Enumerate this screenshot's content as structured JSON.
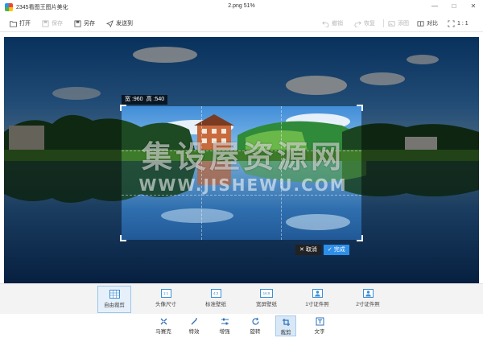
{
  "window": {
    "app_title": "2345看图王图片美化",
    "file_title": "2.png  51%",
    "controls": [
      "—",
      "□",
      "✕"
    ]
  },
  "toolbar": {
    "open": "打开",
    "save": "保存",
    "save_as": "另存",
    "send_to": "发送到",
    "undo": "撤销",
    "redo": "恢复",
    "add_image": "添图",
    "compare": "对比",
    "ratio": "1 : 1"
  },
  "crop": {
    "width_label": "宽 :960",
    "height_label": "高 :540",
    "cancel": "取消",
    "done": "完成"
  },
  "watermark": {
    "line1": "集设屋资源网",
    "line2": "WWW.JISHEWU.COM"
  },
  "presets": [
    {
      "label": "自由裁剪",
      "icon": "",
      "active": true
    },
    {
      "label": "头像尺寸",
      "icon": "1:1",
      "active": false
    },
    {
      "label": "标准壁纸",
      "icon": "4:3",
      "active": false
    },
    {
      "label": "宽屏壁纸",
      "icon": "16:9",
      "active": false
    },
    {
      "label": "1寸证件照",
      "icon": "person",
      "active": false
    },
    {
      "label": "2寸证件照",
      "icon": "person",
      "active": false
    }
  ],
  "tools": [
    {
      "label": "马赛克",
      "icon": "mosaic-icon",
      "active": false
    },
    {
      "label": "特效",
      "icon": "magic-wand-icon",
      "active": false
    },
    {
      "label": "增强",
      "icon": "sliders-icon",
      "active": false
    },
    {
      "label": "旋转",
      "icon": "rotate-icon",
      "active": false
    },
    {
      "label": "裁剪",
      "icon": "crop-icon",
      "active": true
    },
    {
      "label": "文字",
      "icon": "text-icon",
      "active": false
    }
  ],
  "colors": {
    "accent": "#2e8fe8",
    "preset_border": "#3b8fd6"
  }
}
